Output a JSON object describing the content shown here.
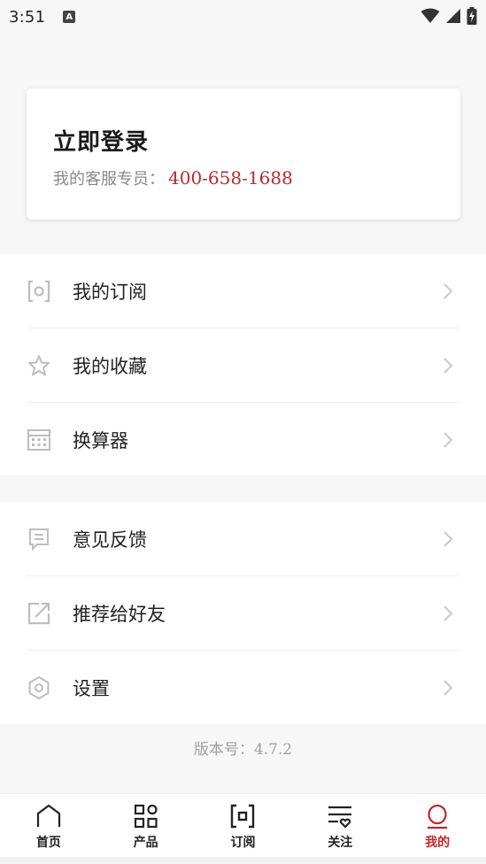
{
  "status_bar": {
    "time": "3:51",
    "notification_letter": "A"
  },
  "login_card": {
    "title": "立即登录",
    "contact_label": "我的客服专员：",
    "phone": "400-658-1688"
  },
  "menu_group_1": [
    {
      "label": "我的订阅",
      "icon": "subscription-frame-icon"
    },
    {
      "label": "我的收藏",
      "icon": "star-icon"
    },
    {
      "label": "换算器",
      "icon": "calculator-icon"
    }
  ],
  "menu_group_2": [
    {
      "label": "意见反馈",
      "icon": "feedback-icon"
    },
    {
      "label": "推荐给好友",
      "icon": "share-icon"
    },
    {
      "label": "设置",
      "icon": "settings-hexagon-icon"
    }
  ],
  "version": "版本号：4.7.2",
  "bottom_nav": [
    {
      "label": "首页",
      "icon": "home-icon",
      "active": false
    },
    {
      "label": "产品",
      "icon": "grid-icon",
      "active": false
    },
    {
      "label": "订阅",
      "icon": "subscribe-icon",
      "active": false
    },
    {
      "label": "关注",
      "icon": "follow-list-icon",
      "active": false
    },
    {
      "label": "我的",
      "icon": "profile-icon",
      "active": true
    }
  ],
  "colors": {
    "accent": "#c0282d",
    "text": "#222222",
    "muted": "#888888",
    "icon_gray": "#bdbdbd",
    "background": "#f7f7f7"
  }
}
